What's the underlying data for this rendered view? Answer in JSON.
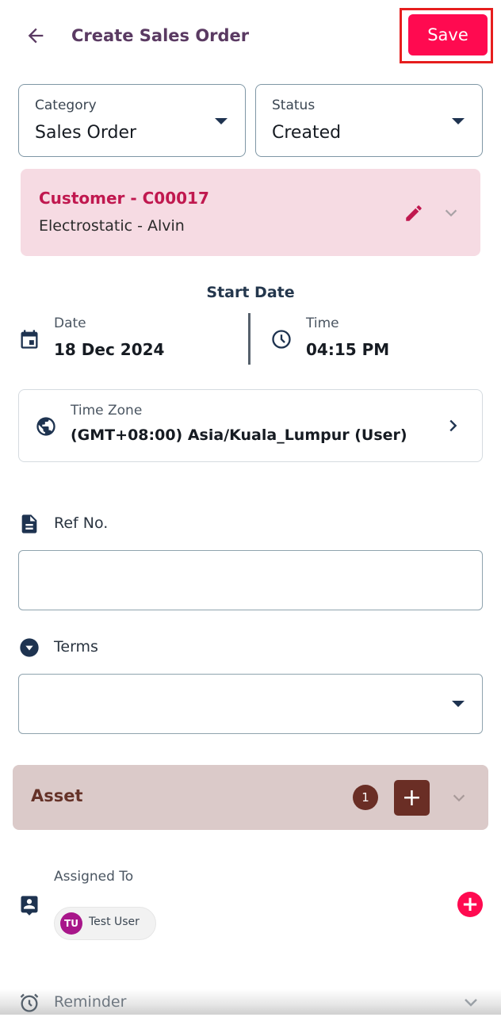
{
  "header": {
    "title": "Create Sales Order",
    "save_label": "Save"
  },
  "category": {
    "label": "Category",
    "value": "Sales Order"
  },
  "status": {
    "label": "Status",
    "value": "Created"
  },
  "customer": {
    "title": "Customer  -  C00017",
    "subtitle": "Electrostatic  - Alvin"
  },
  "start_date": {
    "title": "Start Date",
    "date_label": "Date",
    "date_value": "18 Dec 2024",
    "time_label": "Time",
    "time_value": "04:15 PM"
  },
  "timezone": {
    "label": "Time Zone",
    "value": "(GMT+08:00) Asia/Kuala_Lumpur (User)"
  },
  "ref_no": {
    "label": "Ref No.",
    "value": ""
  },
  "terms": {
    "label": "Terms",
    "value": ""
  },
  "asset": {
    "label": "Asset",
    "count": "1",
    "add_label": "+"
  },
  "assigned": {
    "label": "Assigned To",
    "users": [
      {
        "initials": "TU",
        "name": "Test User"
      }
    ],
    "add_label": "+"
  },
  "reminder": {
    "label": "Reminder"
  },
  "colors": {
    "accent": "#ff0a50",
    "title": "#5a3a62",
    "customer_bg": "#f6dbe3",
    "customer_text": "#c0184f",
    "asset_bg": "#dbcac9",
    "asset_dark": "#6a2e25",
    "icon_navy": "#1e3350",
    "avatar": "#a8168a"
  }
}
